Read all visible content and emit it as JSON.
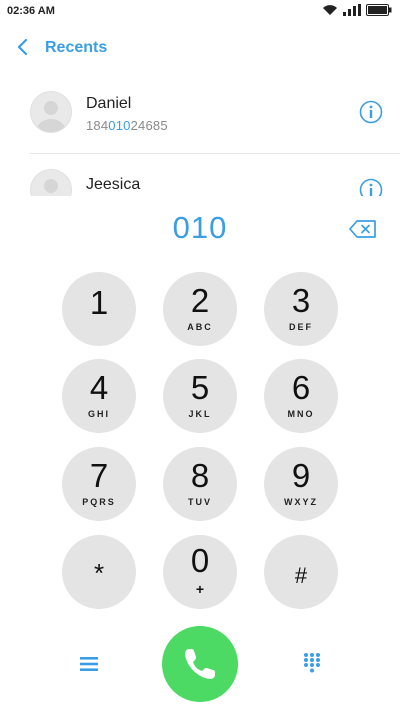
{
  "status_bar": {
    "time": "02:36 AM",
    "icons": [
      "wifi-icon",
      "signal-icon",
      "battery-icon"
    ]
  },
  "header": {
    "title": "Recents",
    "back_icon": "chevron-left-icon"
  },
  "recents": [
    {
      "name": "Daniel",
      "number_prefix": "184",
      "number_match": "010",
      "number_suffix": "24685",
      "info_icon": "info-icon"
    },
    {
      "name": "Jeesica",
      "info_icon": "info-icon"
    }
  ],
  "dialer": {
    "number": "010",
    "backspace_icon": "backspace-icon"
  },
  "keypad": [
    {
      "digit": "1",
      "letters": ""
    },
    {
      "digit": "2",
      "letters": "ABC"
    },
    {
      "digit": "3",
      "letters": "DEF"
    },
    {
      "digit": "4",
      "letters": "GHI"
    },
    {
      "digit": "5",
      "letters": "JKL"
    },
    {
      "digit": "6",
      "letters": "MNO"
    },
    {
      "digit": "7",
      "letters": "PQRS"
    },
    {
      "digit": "8",
      "letters": "TUV"
    },
    {
      "digit": "9",
      "letters": "WXYZ"
    },
    {
      "digit": "*",
      "letters": ""
    },
    {
      "digit": "0",
      "letters": "+"
    },
    {
      "digit": "#",
      "letters": ""
    }
  ],
  "bottom_bar": {
    "menu_icon": "menu-icon",
    "call_icon": "phone-icon",
    "keypad_icon": "keypad-icon"
  },
  "colors": {
    "accent": "#3a9ee4",
    "call": "#4cd964",
    "key_bg": "#e4e4e4"
  }
}
